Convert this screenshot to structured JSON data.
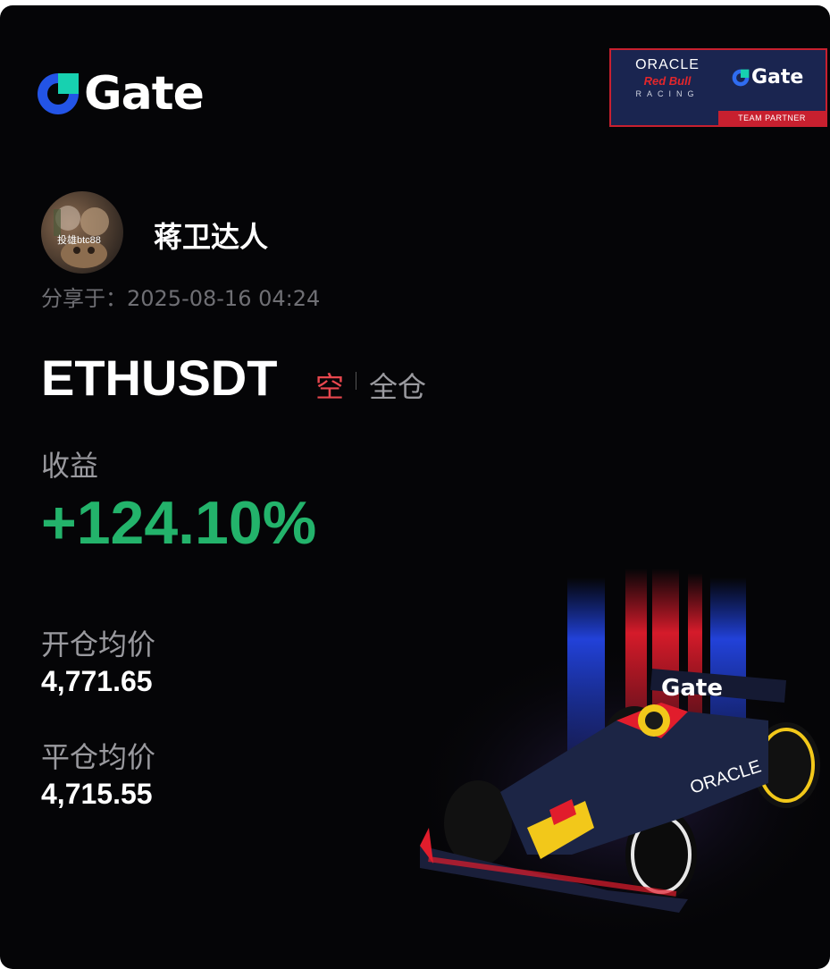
{
  "brand": {
    "name": "Gate",
    "icon": "gate-logo-icon",
    "accent": "#2354e6"
  },
  "partner_badge": {
    "oracle": "ORACLE",
    "redbull": "Red Bull",
    "racing": "RACING",
    "gate": "Gate",
    "caption": "TEAM PARTNER"
  },
  "user": {
    "name": "蒋卫达人",
    "avatar_overlay": "投雄btc88",
    "shared_label": "分享于：2025-08-16 04:24"
  },
  "position": {
    "symbol": "ETHUSDT",
    "direction": "空",
    "margin_mode": "全仓",
    "profit_label": "收益",
    "profit_value": "+124.10%",
    "open_label": "开仓均价",
    "open_value": "4,771.65",
    "close_label": "平仓均价",
    "close_value": "4,715.55"
  },
  "colors": {
    "background": "#050507",
    "profit": "#23b36b",
    "short": "#e8474e",
    "muted": "#9a9a9f"
  },
  "car": {
    "sponsor_text": "Gate",
    "sponsor_text_2": "ORACLE"
  }
}
